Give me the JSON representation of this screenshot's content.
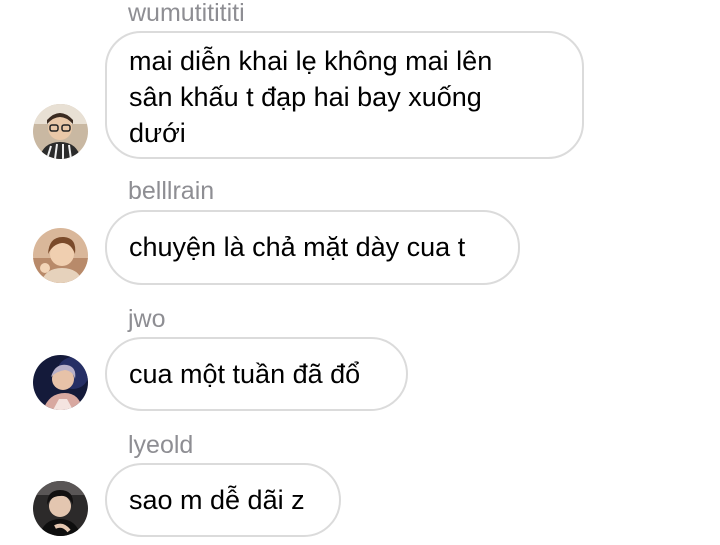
{
  "messages": [
    {
      "sender": "wumutitititi",
      "text": "mai diễn khai lẹ không mai lên\nsân khấu t đạp hai bay xuống\ndưới",
      "avatar": "avatar-person-glasses"
    },
    {
      "sender": "belllrain",
      "text": "chuyện là chả mặt dày cua t",
      "avatar": "avatar-person-brown-hair"
    },
    {
      "sender": "jwo",
      "text": "cua một tuần đã đổ",
      "avatar": "avatar-person-dark-blue"
    },
    {
      "sender": "lyeold",
      "text": "sao m dễ dãi z",
      "avatar": "avatar-person-dark-hair"
    }
  ],
  "colors": {
    "bubble_border": "#dbdbdb",
    "sender_name": "#8e8e93",
    "message_text": "#000000",
    "background": "#ffffff"
  }
}
